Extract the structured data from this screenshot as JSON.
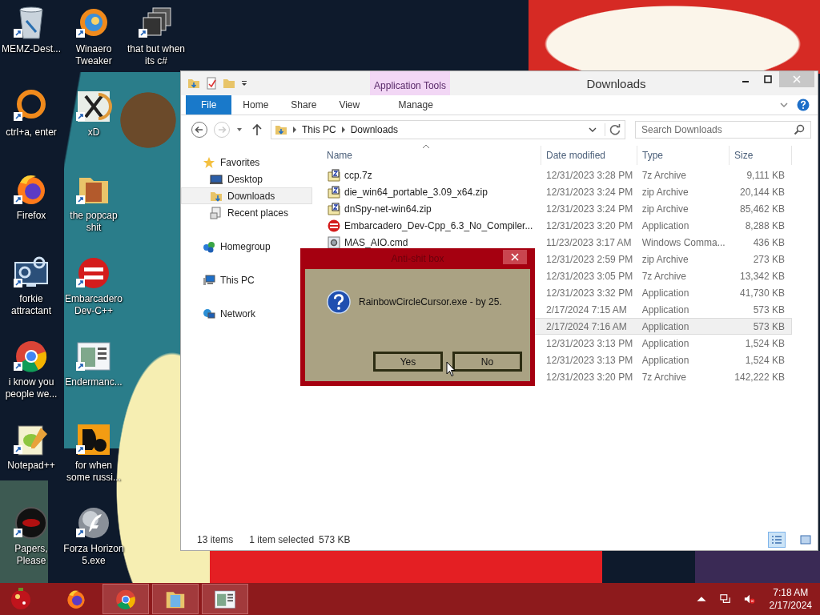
{
  "desktop_icons": [
    {
      "label": "MEMZ-Dest..."
    },
    {
      "label": "Winaero Tweaker"
    },
    {
      "label": "that but when its c#"
    },
    {
      "label": "ctrl+a, enter"
    },
    {
      "label": "xD"
    },
    {
      "label": "Firefox"
    },
    {
      "label": "the popcap shit"
    },
    {
      "label": "forkie attractant"
    },
    {
      "label": "Embarcadero Dev-C++"
    },
    {
      "label": "i know you people we..."
    },
    {
      "label": "Endermanc..."
    },
    {
      "label": "Notepad++"
    },
    {
      "label": "for when some russi..."
    },
    {
      "label": "Papers, Please"
    },
    {
      "label": "Forza Horizon 5.exe"
    }
  ],
  "explorer": {
    "title": "Downloads",
    "context_group": "Application Tools",
    "ribbon_tabs": [
      {
        "label": "File",
        "kind": "file"
      },
      {
        "label": "Home",
        "kind": "tab"
      },
      {
        "label": "Share",
        "kind": "tab"
      },
      {
        "label": "View",
        "kind": "tab"
      },
      {
        "label": "Manage",
        "kind": "context"
      }
    ],
    "breadcrumb": [
      "This PC",
      "Downloads"
    ],
    "search": {
      "placeholder": "Search Downloads"
    },
    "nav": [
      {
        "label": "Favorites",
        "selected": false,
        "children": [
          {
            "label": "Desktop",
            "selected": false
          },
          {
            "label": "Downloads",
            "selected": true
          },
          {
            "label": "Recent places",
            "selected": false
          }
        ]
      },
      {
        "label": "Homegroup",
        "selected": false
      },
      {
        "label": "This PC",
        "selected": false
      },
      {
        "label": "Network",
        "selected": false
      }
    ],
    "columns": [
      "Name",
      "Date modified",
      "Type",
      "Size"
    ],
    "rows": [
      {
        "name": "ccp.7z",
        "kind": "archive",
        "date": "12/31/2023 3:28 PM",
        "type": "7z Archive",
        "size": "9,111 KB",
        "selected": false
      },
      {
        "name": "die_win64_portable_3.09_x64.zip",
        "kind": "archive",
        "date": "12/31/2023 3:24 PM",
        "type": "zip Archive",
        "size": "20,144 KB",
        "selected": false
      },
      {
        "name": "dnSpy-net-win64.zip",
        "kind": "archive",
        "date": "12/31/2023 3:24 PM",
        "type": "zip Archive",
        "size": "85,462 KB",
        "selected": false
      },
      {
        "name": "Embarcadero_Dev-Cpp_6.3_No_Compiler...",
        "kind": "application",
        "date": "12/31/2023 3:20 PM",
        "type": "Application",
        "size": "8,288 KB",
        "selected": false
      },
      {
        "name": "MAS_AIO.cmd",
        "kind": "script",
        "date": "11/23/2023 3:17 AM",
        "type": "Windows Comma...",
        "size": "436 KB",
        "selected": false
      },
      {
        "date": "12/31/2023 2:59 PM",
        "type": "zip Archive",
        "size": "273 KB",
        "selected": false
      },
      {
        "date": "12/31/2023 3:05 PM",
        "type": "7z Archive",
        "size": "13,342 KB",
        "selected": false
      },
      {
        "date": "12/31/2023 3:32 PM",
        "type": "Application",
        "size": "41,730 KB",
        "selected": false
      },
      {
        "date": "2/17/2024 7:15 AM",
        "type": "Application",
        "size": "573 KB",
        "selected": false
      },
      {
        "date": "2/17/2024 7:16 AM",
        "type": "Application",
        "size": "573 KB",
        "selected": true
      },
      {
        "date": "12/31/2023 3:13 PM",
        "type": "Application",
        "size": "1,524 KB",
        "selected": false
      },
      {
        "date": "12/31/2023 3:13 PM",
        "type": "Application",
        "size": "1,524 KB",
        "selected": false
      },
      {
        "date": "12/31/2023 3:20 PM",
        "type": "7z Archive",
        "size": "142,222 KB",
        "selected": false
      }
    ],
    "status": {
      "count": "13 items",
      "selection": "1 item selected",
      "selection_size": "573 KB"
    },
    "views": [
      {
        "selected": true
      },
      {
        "selected": false
      }
    ]
  },
  "dialog": {
    "title": "Anti-shit box",
    "message": "RainbowCircleCursor.exe - by 25.",
    "buttons": [
      "Yes",
      "No"
    ]
  },
  "taskbar": {
    "apps": [
      {
        "running": false
      },
      {
        "running": true
      },
      {
        "running": true
      },
      {
        "running": true
      }
    ],
    "time": "7:18 AM",
    "date": "2/17/2024"
  }
}
